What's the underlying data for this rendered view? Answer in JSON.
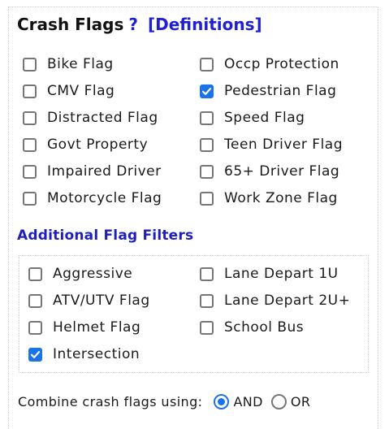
{
  "header": {
    "title": "Crash Flags",
    "help": "?",
    "definitions": "[Definitions]"
  },
  "crash_flags": [
    {
      "label": "Bike Flag",
      "checked": false
    },
    {
      "label": "Occp Protection",
      "checked": false
    },
    {
      "label": "CMV Flag",
      "checked": false
    },
    {
      "label": "Pedestrian Flag",
      "checked": true
    },
    {
      "label": "Distracted Flag",
      "checked": false
    },
    {
      "label": "Speed Flag",
      "checked": false
    },
    {
      "label": "Govt Property",
      "checked": false
    },
    {
      "label": "Teen Driver Flag",
      "checked": false
    },
    {
      "label": "Impaired Driver",
      "checked": false
    },
    {
      "label": "65+ Driver Flag",
      "checked": false
    },
    {
      "label": "Motorcycle Flag",
      "checked": false
    },
    {
      "label": "Work Zone Flag",
      "checked": false
    }
  ],
  "additional": {
    "heading": "Additional Flag Filters",
    "items": [
      {
        "label": "Aggressive",
        "checked": false
      },
      {
        "label": "Lane Depart 1U",
        "checked": false
      },
      {
        "label": "ATV/UTV Flag",
        "checked": false
      },
      {
        "label": "Lane Depart 2U+",
        "checked": false
      },
      {
        "label": "Helmet Flag",
        "checked": false
      },
      {
        "label": "School Bus",
        "checked": false
      },
      {
        "label": "Intersection",
        "checked": true
      }
    ]
  },
  "combine": {
    "label": "Combine crash flags using:",
    "options": [
      {
        "label": "AND",
        "selected": true
      },
      {
        "label": "OR",
        "selected": false
      }
    ]
  },
  "colors": {
    "accent": "#1a73e8",
    "link": "#1f1fd6",
    "subheading": "#1f1fbf"
  }
}
